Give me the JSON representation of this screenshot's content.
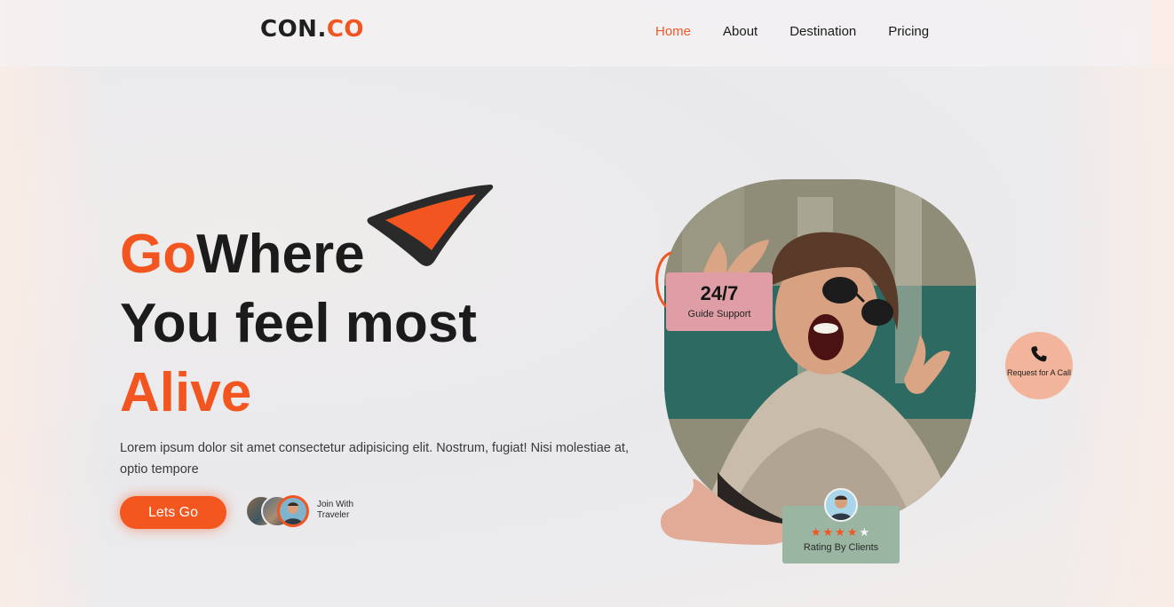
{
  "colors": {
    "accent": "#f25520",
    "nav_active": "#ef5a2b",
    "support_card": "#df9ea6",
    "rating_card": "#9ab6a2",
    "call_bubble": "#f2b49a"
  },
  "nav": {
    "logo_main": "CON.",
    "logo_accent": "CO",
    "links": [
      "Home",
      "About",
      "Destination",
      "Pricing"
    ],
    "active": "Home"
  },
  "hero": {
    "line1_accent": "Go",
    "line1_rest": "Where",
    "line2": "You feel most",
    "line3": "Alive",
    "description": "Lorem ipsum dolor sit amet consectetur adipisicing elit. Nostrum, fugiat! Nisi molestiae at, optio tempore",
    "cta": "Lets Go",
    "join_text": "Join With Traveler"
  },
  "cards": {
    "support_title": "24/7",
    "support_sub": "Guide Support",
    "call_text": "Request for A Call",
    "rating_label": "Rating By Clients",
    "rating_stars": 4,
    "rating_max": 5
  },
  "icons": [
    "phone-icon",
    "paper-plane-arrow-icon",
    "star-icon"
  ]
}
